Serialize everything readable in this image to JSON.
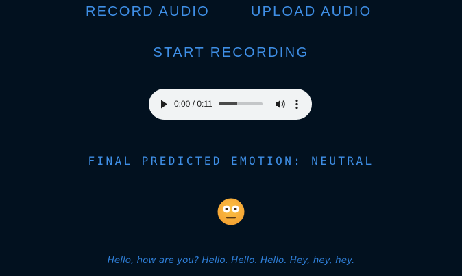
{
  "tabs": {
    "record_audio": "RECORD AUDIO",
    "upload_audio": "UPLOAD AUDIO"
  },
  "start_recording_label": "START RECORDING",
  "audio_player": {
    "time_display": "0:00 / 0:11",
    "buffered_fraction": 0.42,
    "play_icon": "play-icon",
    "volume_icon": "volume-icon",
    "more_icon": "more-vertical-icon"
  },
  "result": {
    "emotion_text": "FINAL PREDICTED EMOTION: NEUTRAL",
    "emoji_name": "neutral-face-emoji"
  },
  "transcript": "Hello, how are you? Hello. Hello. Hello. Hey, hey, hey.",
  "colors": {
    "background": "#02111f",
    "accent": "#3f8fe6",
    "player_bg": "#f1f3f4",
    "emoji_face": "#f7a83a"
  }
}
